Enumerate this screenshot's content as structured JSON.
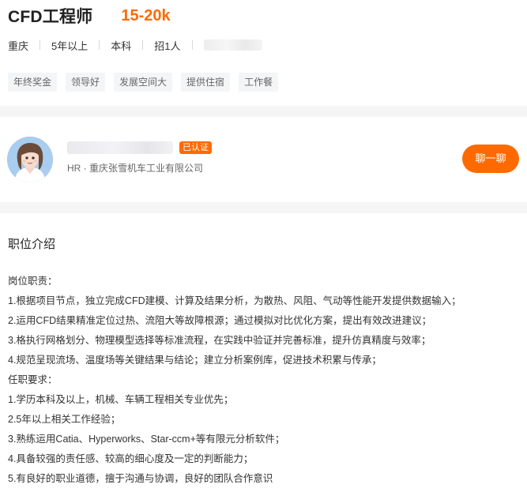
{
  "job": {
    "title": "CFD工程师",
    "salary": "15-20k",
    "meta": [
      "重庆",
      "5年以上",
      "本科",
      "招1人"
    ],
    "tags": [
      "年终奖金",
      "领导好",
      "发展空间大",
      "提供住宿",
      "工作餐"
    ]
  },
  "recruiter": {
    "verified_badge": "已认证",
    "company_line": "HR · 重庆张雪机车工业有限公司",
    "chat_button": "聊一聊"
  },
  "description": {
    "heading": "职位介绍",
    "lines": [
      "岗位职责：",
      "1.根据项目节点，独立完成CFD建模、计算及结果分析，为散热、风阻、气动等性能开发提供数据输入；",
      "2.运用CFD结果精准定位过热、流阻大等故障根源；通过模拟对比优化方案，提出有效改进建议；",
      "3.格执行网格划分、物理模型选择等标准流程，在实践中验证并完善标准，提升仿真精度与效率；",
      "4.规范呈现流场、温度场等关键结果与结论；建立分析案例库，促进技术积累与传承；",
      "任职要求：",
      "1.学历本科及以上，机械、车辆工程相关专业优先；",
      "2.5年以上相关工作经验；",
      "3.熟练运用Catia、Hyperworks、Star-ccm+等有限元分析软件；",
      "4.具备较强的责任感、较高的细心度及一定的判断能力；",
      "5.有良好的职业道德，擅于沟通与协调，良好的团队合作意识"
    ]
  },
  "colors": {
    "accent": "#ff6a00",
    "tag_bg": "#f4f5f7",
    "band": "#f5f5f5"
  }
}
